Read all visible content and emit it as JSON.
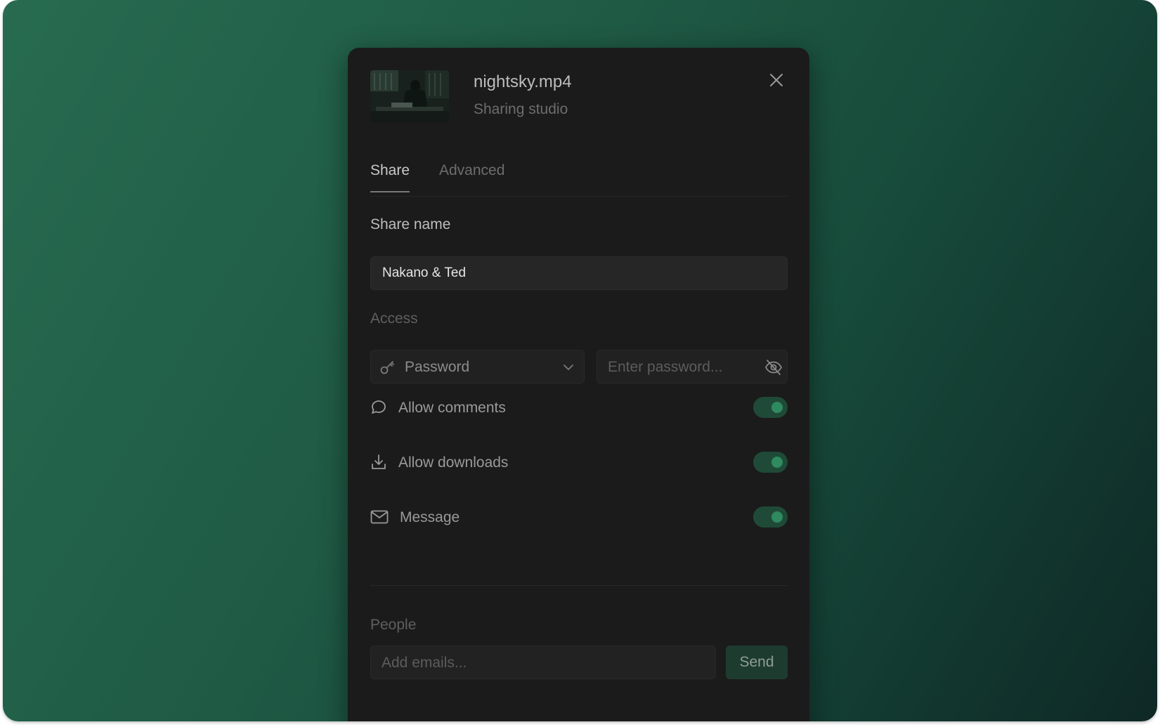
{
  "file": {
    "title": "nightsky.mp4",
    "subtitle": "Sharing studio"
  },
  "tabs": [
    {
      "label": "Share",
      "active": true
    },
    {
      "label": "Advanced",
      "active": false
    }
  ],
  "share_name": {
    "label": "Share name",
    "value": "Nakano & Ted"
  },
  "access": {
    "label": "Access",
    "selected": "Password",
    "password_placeholder": "Enter password..."
  },
  "options": [
    {
      "label": "Allow comments",
      "icon": "comment-icon",
      "enabled": true
    },
    {
      "label": "Allow downloads",
      "icon": "download-icon",
      "enabled": true
    },
    {
      "label": "Message",
      "icon": "mail-icon",
      "enabled": true
    }
  ],
  "people": {
    "label": "People",
    "email_placeholder": "Add emails...",
    "send_label": "Send"
  },
  "colors": {
    "background_start": "#276b50",
    "background_end": "#0e2826",
    "modal": "#1b1b1b",
    "toggle_on": "#2f8a60"
  }
}
